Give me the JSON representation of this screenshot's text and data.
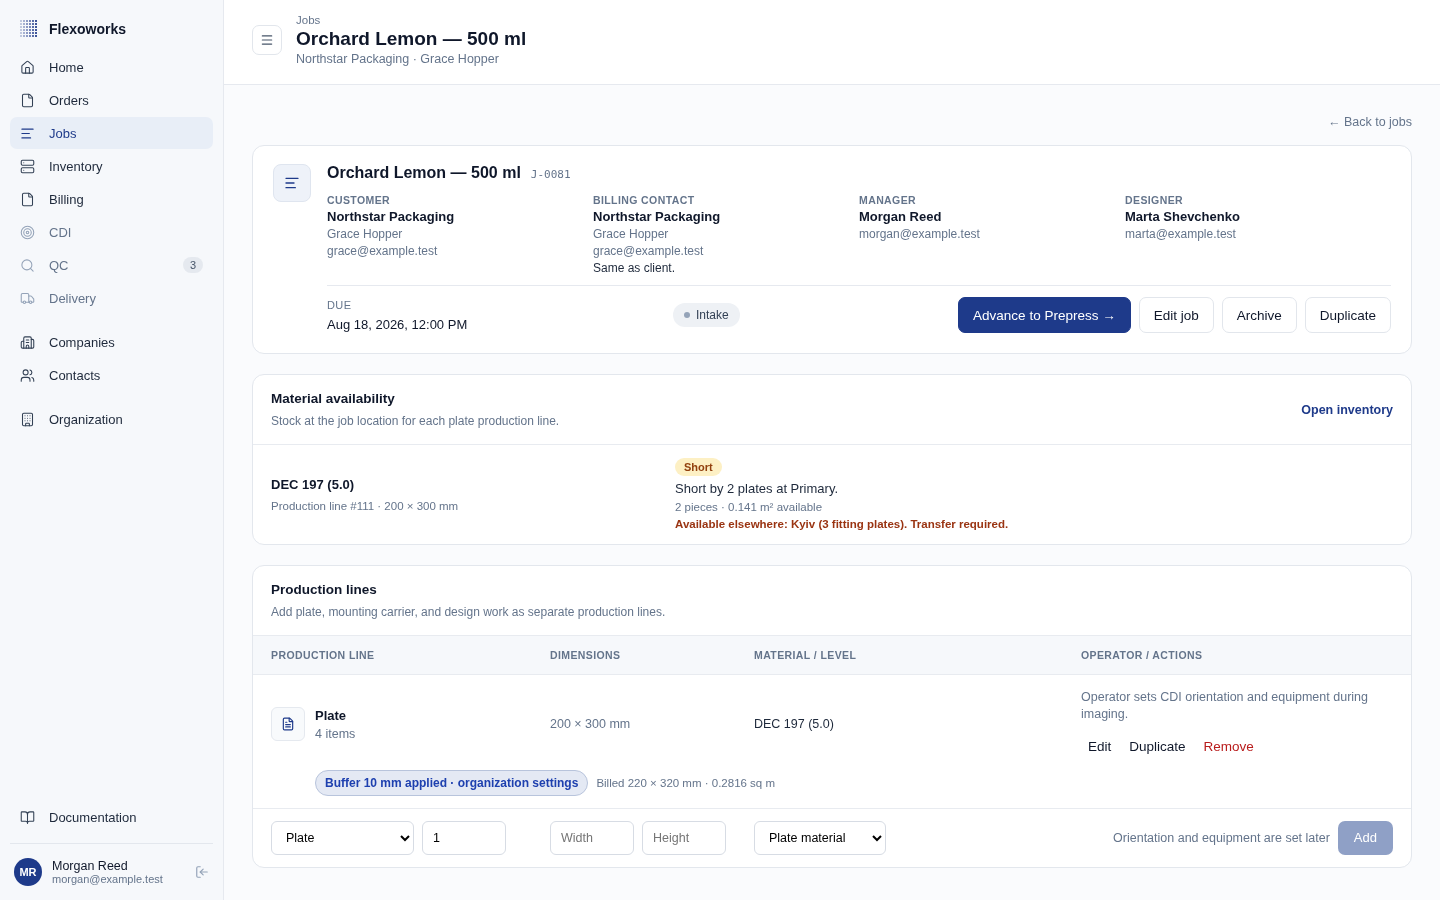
{
  "app": {
    "name": "Flexoworks"
  },
  "sidebar": {
    "sections": [
      {
        "items": [
          {
            "label": "Home",
            "selected": false,
            "disabled": false
          },
          {
            "label": "Orders",
            "selected": false,
            "disabled": false
          },
          {
            "label": "Jobs",
            "selected": true,
            "disabled": false
          },
          {
            "label": "Inventory",
            "selected": false,
            "disabled": false
          },
          {
            "label": "Billing",
            "selected": false,
            "disabled": false
          },
          {
            "label": "CDI",
            "selected": false,
            "disabled": true
          },
          {
            "label": "QC",
            "selected": false,
            "disabled": true,
            "badge": "3"
          },
          {
            "label": "Delivery",
            "selected": false,
            "disabled": true
          }
        ]
      },
      {
        "items": [
          {
            "label": "Companies",
            "selected": false,
            "disabled": false
          },
          {
            "label": "Contacts",
            "selected": false,
            "disabled": false
          }
        ]
      },
      {
        "items": [
          {
            "label": "Organization",
            "selected": false,
            "disabled": false
          }
        ]
      }
    ],
    "documentation": "Documentation",
    "user": {
      "initials": "MR",
      "name": "Morgan Reed",
      "email": "morgan@example.test"
    }
  },
  "header": {
    "breadcrumb": "Jobs",
    "title": "Orchard Lemon — 500 ml",
    "subtitle": "Northstar Packaging · Grace Hopper"
  },
  "back_link": "← Back to jobs",
  "job": {
    "title": "Orchard Lemon — 500 ml",
    "code": "J-0081",
    "contacts": [
      {
        "label": "CUSTOMER",
        "name": "Northstar Packaging",
        "lines": [
          "Grace Hopper",
          "grace@example.test"
        ]
      },
      {
        "label": "BILLING CONTACT",
        "name": "Northstar Packaging",
        "lines": [
          "Grace Hopper",
          "grace@example.test"
        ],
        "note": "Same as client."
      },
      {
        "label": "MANAGER",
        "name": "Morgan Reed",
        "lines": [
          "morgan@example.test"
        ]
      },
      {
        "label": "DESIGNER",
        "name": "Marta Shevchenko",
        "lines": [
          "marta@example.test"
        ]
      }
    ],
    "due": {
      "label": "DUE",
      "value": "Aug 18, 2026, 12:00 PM"
    },
    "status": "Intake",
    "actions": [
      {
        "label": "Advance to Prepress →",
        "kind": "primary"
      },
      {
        "label": "Edit job",
        "kind": "secondary"
      },
      {
        "label": "Archive",
        "kind": "secondary"
      },
      {
        "label": "Duplicate",
        "kind": "secondary"
      }
    ]
  },
  "material": {
    "title": "Material availability",
    "subtitle": "Stock at the job location for each plate production line.",
    "link": "Open inventory",
    "rows": [
      {
        "name": "DEC 197 (5.0)",
        "detail": "Production line #111 · 200 × 300 mm",
        "badge": "Short",
        "message": "Short by 2 plates at Primary.",
        "stock": "2 pieces · 0.141 m² available",
        "elsewhere": "Available elsewhere: Kyiv (3 fitting plates). Transfer required."
      }
    ]
  },
  "production": {
    "title": "Production lines",
    "subtitle": "Add plate, mounting carrier, and design work as separate production lines.",
    "columns": [
      "PRODUCTION LINE",
      "DIMENSIONS",
      "MATERIAL / LEVEL",
      "OPERATOR / ACTIONS"
    ],
    "rows": [
      {
        "name": "Plate",
        "count": "4 items",
        "dimensions": "200 × 300 mm",
        "material": "DEC 197 (5.0)",
        "operator_note": "Operator sets CDI orientation and equipment during imaging.",
        "actions": [
          {
            "label": "Edit",
            "kind": "default"
          },
          {
            "label": "Duplicate",
            "kind": "default"
          },
          {
            "label": "Remove",
            "kind": "danger"
          }
        ],
        "buffer_tag": "Buffer 10 mm applied · organization settings",
        "billed": "Billed 220 × 320 mm · 0.2816 sq m"
      }
    ],
    "add_row": {
      "type": "Plate",
      "quantity": "1",
      "width_placeholder": "Width",
      "height_placeholder": "Height",
      "material": "Plate material",
      "note": "Orientation and equipment are set later",
      "button": "Add",
      "button_disabled": true
    }
  }
}
